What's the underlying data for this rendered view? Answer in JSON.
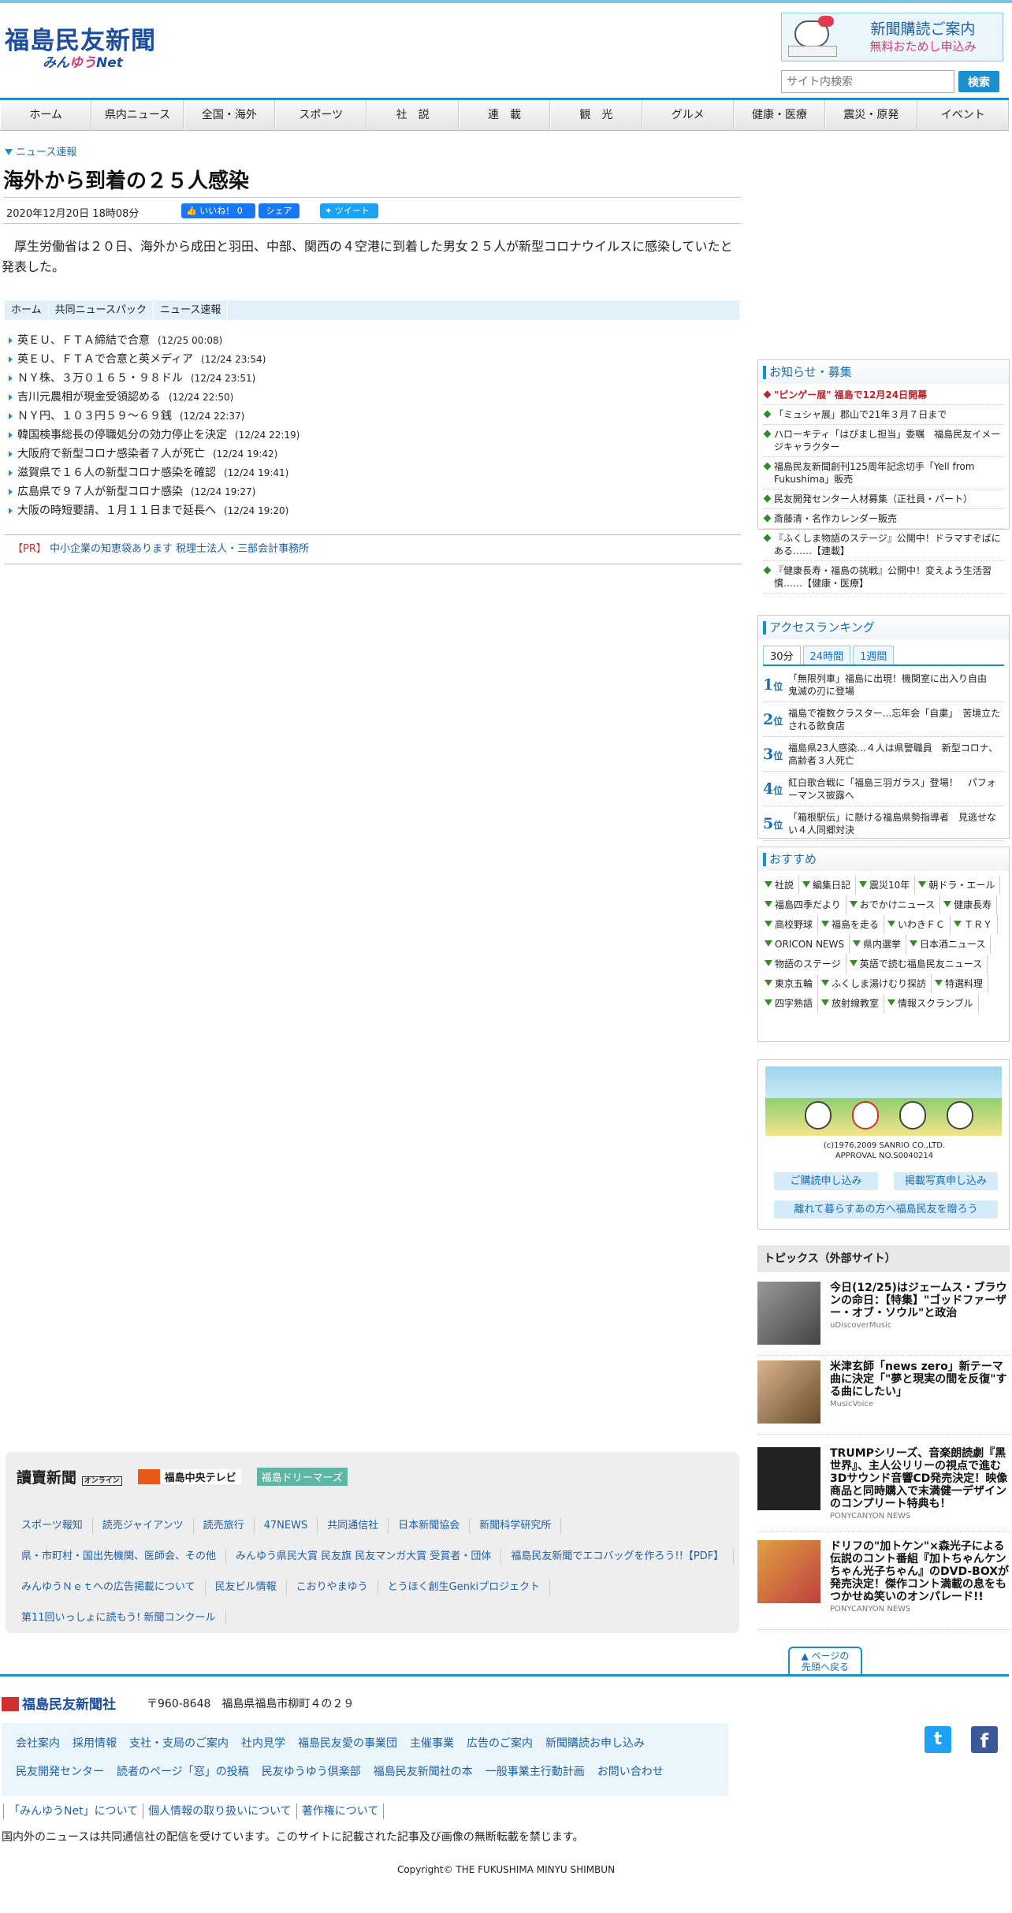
{
  "header": {
    "logo_main": "福島民友新聞",
    "logo_sub_a": "みん",
    "logo_sub_b": "ゆう",
    "logo_sub_c": "Net",
    "sub_banner_line1": "新聞購読ご案内",
    "sub_banner_line2": "無料おためし申込み",
    "search_placeholder": "サイト内検索",
    "search_button": "検索"
  },
  "nav": [
    "ホーム",
    "県内ニュース",
    "全国・海外",
    "スポーツ",
    "社　説",
    "連　載",
    "観　光",
    "グルメ",
    "健康・医療",
    "震災・原発",
    "イベント"
  ],
  "article": {
    "category": "ニュース速報",
    "title": "海外から到着の２５人感染",
    "date": "2020年12月20日 18時08分",
    "like_label": "いいね！ 0",
    "share_label": "シェア",
    "tweet_label": "ツイート",
    "body": "厚生労働省は２０日、海外から成田と羽田、中部、関西の４空港に到着した男女２５人が新型コロナウイルスに感染していたと発表した。"
  },
  "breadcrumb": [
    "ホーム",
    "共同ニュースパック",
    "ニュース速報"
  ],
  "news_list": [
    {
      "title": "英ＥＵ、ＦＴＡ締結で合意",
      "time": "(12/25 00:08)"
    },
    {
      "title": "英ＥＵ、ＦＴＡで合意と英メディア",
      "time": "(12/24 23:54)"
    },
    {
      "title": "ＮＹ株、３万０１６５・９８ドル",
      "time": "(12/24 23:51)"
    },
    {
      "title": "吉川元農相が現金受領認める",
      "time": "(12/24 22:50)"
    },
    {
      "title": "ＮＹ円、１０３円５９～６９銭",
      "time": "(12/24 22:37)"
    },
    {
      "title": "韓国検事総長の停職処分の効力停止を決定",
      "time": "(12/24 22:19)"
    },
    {
      "title": "大阪府で新型コロナ感染者７人が死亡",
      "time": "(12/24 19:42)"
    },
    {
      "title": "滋賀県で１６人の新型コロナ感染を確認",
      "time": "(12/24 19:41)"
    },
    {
      "title": "広島県で９７人が新型コロナ感染",
      "time": "(12/24 19:27)"
    },
    {
      "title": "大阪の時短要請、１月１１日まで延長へ",
      "time": "(12/24 19:20)"
    }
  ],
  "pr": {
    "tag": "【PR】",
    "text": "中小企業の知恵袋あります 税理士法人・三部会計事務所"
  },
  "sidebar": {
    "notice_title": "お知らせ・募集",
    "notices": [
      "\"ピンゲー展\" 福島で12月24日開幕",
      "「ミュシャ展」郡山で21年３月７日まで",
      "ハローキティ「はぴまし担当」委嘱　福島民友イメージキャラクター",
      "福島民友新聞創刊125周年記念切手「Yell from Fukushima」販売",
      "民友開発センター人材募集（正社員・パート）",
      "斎藤清・名作カレンダー販売",
      "『ふくしま物語のステージ』公開中！ドラマすぞばにある……【連載】",
      "『健康長寿・福島の挑戦』公開中！変えよう生活習慣……【健康・医療】"
    ],
    "ranking_title": "アクセスランキング",
    "ranking_tabs": [
      "30分",
      "24時間",
      "1週間"
    ],
    "ranking_suffix": "位",
    "ranking": [
      {
        "rank": "1",
        "title": "「無限列車」福島に出現！機関室に出入り自由　鬼滅の刃に登場"
      },
      {
        "rank": "2",
        "title": "福島で複数クラスター...忘年会「自粛」　苦境立たされる飲食店"
      },
      {
        "rank": "3",
        "title": "福島県23人感染...４人は県警職員　新型コロナ、高齢者３人死亡"
      },
      {
        "rank": "4",
        "title": "紅白歌合戦に「福島三羽ガラス」登場！　パフォーマンス披露へ"
      },
      {
        "rank": "5",
        "title": "「箱根駅伝」に懸ける福島県勢指導者　見逃せない４人同郷対決"
      }
    ],
    "reco_title": "おすすめ",
    "reco_tags": [
      "社説",
      "編集日記",
      "震災10年",
      "朝ドラ・エール",
      "福島四季だより",
      "おでかけニュース",
      "健康長寿",
      "高校野球",
      "福島を走る",
      "いわきＦＣ",
      "ＴＲＹ",
      "ORICON NEWS",
      "県内選挙",
      "日本酒ニュース",
      "物語のステージ",
      "英語で読む福島民友ニュース",
      "東京五輪",
      "ふくしま湯けむり探訪",
      "特選料理",
      "四字熟語",
      "放射線教室",
      "情報スクランブル"
    ],
    "kitty_copy_line1": "(c)1976,2009 SANRIO CO.,LTD.",
    "kitty_copy_line2": "APPROVAL NO.S0040214",
    "kitty_btn1": "ご購読申し込み",
    "kitty_btn2": "掲載写真申し込み",
    "kitty_btn3": "離れて暮らすあの方へ福島民友を贈ろう",
    "topics_title": "トピックス（外部サイト）",
    "topics": [
      {
        "title": "今日(12/25)はジェームス・ブラウンの命日：【特集】\"ゴッドファーザー・オブ・ソウル\"と政治",
        "source": "uDiscoverMusic"
      },
      {
        "title": "米津玄師「news zero」新テーマ曲に決定「\"夢と現実の間を反復\"する曲にしたい」",
        "source": "MusicVoice"
      },
      {
        "title": "TRUMPシリーズ、音楽朗読劇『黑世界』、主人公リリーの視点で進む3Dサウンド音響CD発売決定！映像商品と同時購入で末満健一デザインのコンプリート特典も！",
        "source": "PONYCANYON NEWS"
      },
      {
        "title": "ドリフの\"加トケン\"×森光子による伝説のコント番組『加トちゃんケンちゃん光子ちゃん』のDVD-BOXが発売決定！傑作コント満載の息をもつかせぬ笑いのオンパレード!!",
        "source": "PONYCANYON NEWS"
      }
    ]
  },
  "footer": {
    "logo1": "讀賣新聞",
    "logo1b": "オンライン",
    "logo2": "福島中央テレビ",
    "logo3": "福島ドリーマーズ",
    "row1": [
      "スポーツ報知",
      "読売ジャイアンツ",
      "読売旅行",
      "47NEWS",
      "共同通信社",
      "日本新聞協会",
      "新聞科学研究所"
    ],
    "row2": [
      "県・市町村・国出先機関、医師会、その他",
      "みんゆう県民大賞 民友旗 民友マンガ大賞 受賞者・団体",
      "福島民友新聞でエコバッグを作ろう!!【PDF】"
    ],
    "row3": [
      "みんゆうＮｅｔへの広告掲載について",
      "民友ビル情報",
      "こおりやまゆう",
      "とうほく創生Genkiプロジェクト"
    ],
    "row4": [
      "第11回いっしょに読もう! 新聞コンクール"
    ],
    "to_top_line1": "▲ ページの",
    "to_top_line2": "先頭へ戻る",
    "company": "福島民友新聞社",
    "address": "〒960-8648　福島県福島市柳町４の２９",
    "corp_row1": [
      "会社案内",
      "採用情報",
      "支社・支局のご案内",
      "社内見学",
      "福島民友愛の事業団",
      "主催事業",
      "広告のご案内",
      "新聞購読お申し込み"
    ],
    "corp_row2": [
      "民友開発センター",
      "読者のページ「窓」の投稿",
      "民友ゆうゆう倶楽部",
      "福島民友新聞社の本",
      "一般事業主行動計画",
      "お問い合わせ"
    ],
    "links": [
      "「みんゆうNet」について",
      "個人情報の取り扱いについて",
      "著作権について"
    ],
    "notice": "国内外のニュースは共同通信社の配信を受けています。このサイトに記載された記事及び画像の無断転載を禁じます。",
    "copyright": "Copyright© THE FUKUSHIMA MINYU SHIMBUN"
  }
}
